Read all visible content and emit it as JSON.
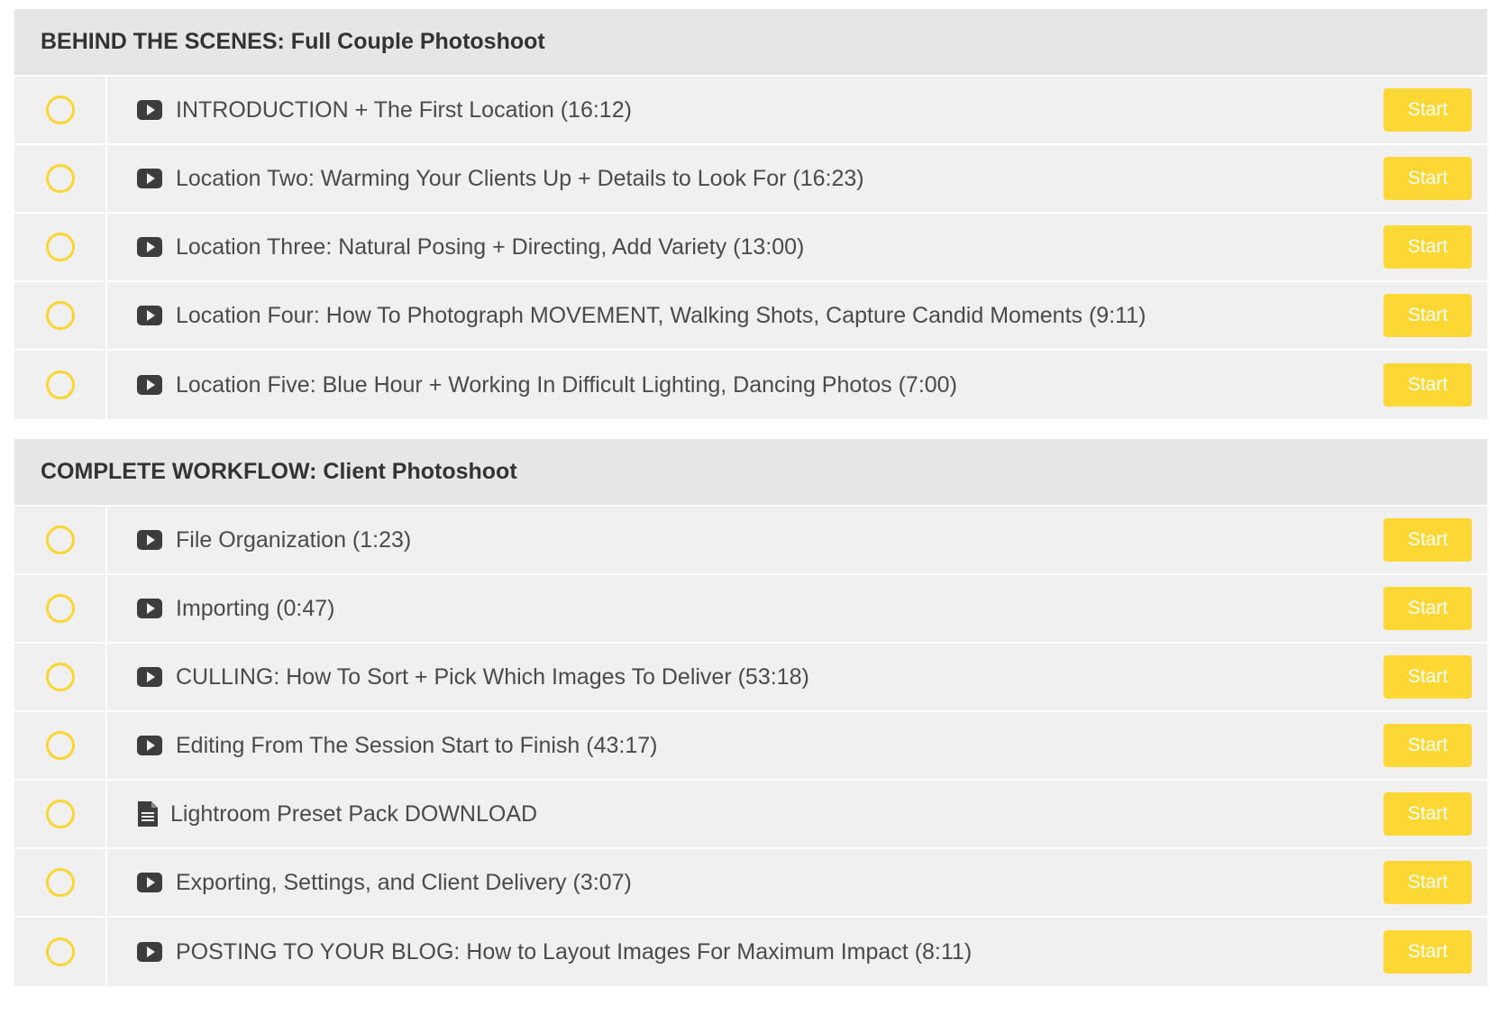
{
  "colors": {
    "accent": "#fdd835",
    "circle": "#fbd531",
    "row_bg": "#f0f0f0",
    "header_bg": "#e6e6e6",
    "text": "#4a4a4a"
  },
  "sections": [
    {
      "title": "BEHIND THE SCENES: Full Couple Photoshoot",
      "lessons": [
        {
          "title": "INTRODUCTION + The First Location (16:12)",
          "icon": "video-play-icon",
          "button": "Start"
        },
        {
          "title": "Location Two: Warming Your Clients Up + Details to Look For (16:23)",
          "icon": "video-play-icon",
          "button": "Start"
        },
        {
          "title": "Location Three: Natural Posing + Directing, Add Variety (13:00)",
          "icon": "video-play-icon",
          "button": "Start"
        },
        {
          "title": "Location Four: How To Photograph MOVEMENT, Walking Shots, Capture Candid Moments (9:11)",
          "icon": "video-play-icon",
          "button": "Start"
        },
        {
          "title": "Location Five: Blue Hour + Working In Difficult Lighting, Dancing Photos (7:00)",
          "icon": "video-play-icon",
          "button": "Start"
        }
      ]
    },
    {
      "title": "COMPLETE WORKFLOW: Client Photoshoot",
      "lessons": [
        {
          "title": "File Organization (1:23)",
          "icon": "video-play-icon",
          "button": "Start"
        },
        {
          "title": "Importing (0:47)",
          "icon": "video-play-icon",
          "button": "Start"
        },
        {
          "title": "CULLING: How To Sort + Pick Which Images To Deliver (53:18)",
          "icon": "video-play-icon",
          "button": "Start"
        },
        {
          "title": "Editing From The Session Start to Finish (43:17)",
          "icon": "video-play-icon",
          "button": "Start"
        },
        {
          "title": "Lightroom Preset Pack DOWNLOAD",
          "icon": "document-icon",
          "button": "Start"
        },
        {
          "title": "Exporting, Settings, and Client Delivery (3:07)",
          "icon": "video-play-icon",
          "button": "Start"
        },
        {
          "title": "POSTING TO YOUR BLOG: How to Layout Images For Maximum Impact (8:11)",
          "icon": "video-play-icon",
          "button": "Start"
        }
      ]
    }
  ]
}
